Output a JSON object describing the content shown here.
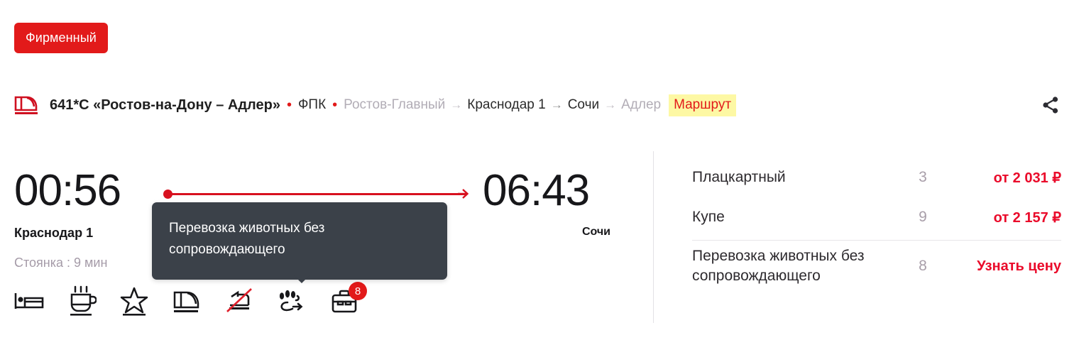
{
  "badge": {
    "label": "Фирменный"
  },
  "train": {
    "logo_icon": "train-front-icon",
    "number": "641*С «Ростов-на-Дону – Адлер»",
    "separator": "•",
    "carrier": "ФПК",
    "route": [
      {
        "name": "Ростов-Главный",
        "dim": true
      },
      {
        "name": "Краснодар 1",
        "dim": false
      },
      {
        "name": "Сочи",
        "dim": false
      },
      {
        "name": "Адлер",
        "dim": true
      }
    ],
    "route_arrow": "→",
    "route_link_label": "Маршрут",
    "route_link_color": "#e21a1a",
    "route_link_highlight": "#fdf8a4",
    "share_icon": "share-icon"
  },
  "timeline": {
    "departure_time": "00:56",
    "departure_station": "Краснодар 1",
    "stop_info": "Стоянка : 9 мин",
    "arrival_time": "06:43",
    "arrival_station": "Сочи",
    "line_color": "#d8111f"
  },
  "amenities": [
    {
      "icon": "bed-icon",
      "state": "available",
      "badge": ""
    },
    {
      "icon": "hot-drink-icon",
      "state": "available",
      "badge": ""
    },
    {
      "icon": "star-icon",
      "state": "available",
      "badge": ""
    },
    {
      "icon": "train-front-icon",
      "state": "available",
      "badge": ""
    },
    {
      "icon": "no-device-icon",
      "state": "unavailable",
      "badge": ""
    },
    {
      "icon": "paw-transport-icon",
      "state": "selected",
      "badge": ""
    },
    {
      "icon": "briefcase-icon",
      "state": "available",
      "badge": "8"
    }
  ],
  "tooltip": {
    "text": "Перевозка животных без сопровождающего",
    "background": "#3b4149"
  },
  "prices": {
    "rows": [
      {
        "name": "Плацкартный",
        "count": "3",
        "price": "от 2 031 ₽"
      },
      {
        "name": "Купе",
        "count": "9",
        "price": "от 2 157 ₽"
      },
      {
        "name": "Перевозка животных без сопровождающего",
        "count": "8",
        "price": "Узнать цену"
      }
    ],
    "price_color": "#ea0a2a"
  }
}
